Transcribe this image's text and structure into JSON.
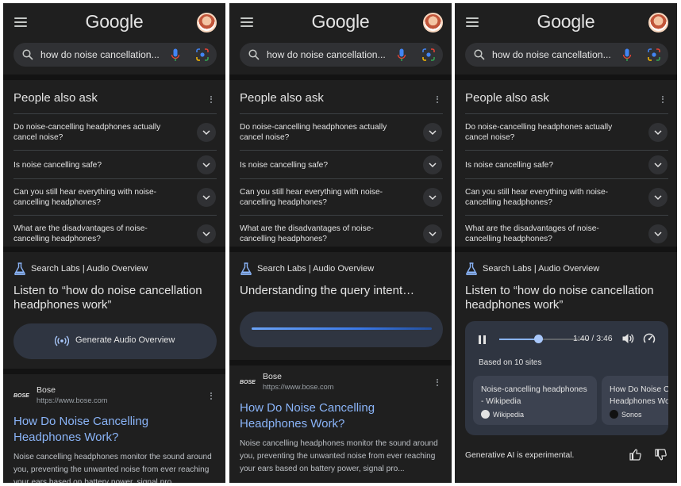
{
  "header": {
    "logo": "Google"
  },
  "search": {
    "query": "how do noise cancellation..."
  },
  "paa": {
    "title": "People also ask",
    "questions": [
      "Do noise-cancelling headphones actually cancel noise?",
      "Is noise cancelling safe?",
      "Can you still hear everything with noise-cancelling headphones?",
      "What are the disadvantages of noise-cancelling headphones?"
    ]
  },
  "audio": {
    "labs_label": "Search Labs | Audio Overview",
    "prompt": "Listen to “how do noise cancellation headphones work”",
    "generate_label": "Generate Audio Overview",
    "loading_text": "Understanding the query intent…",
    "player": {
      "time": "1:40 / 3:46",
      "progress": 0.44,
      "based_on": "Based on 10 sites",
      "sources": [
        {
          "title": "Noise-cancelling headphones - Wikipedia",
          "site": "Wikipedia"
        },
        {
          "title": "How Do Noise Cancelling Headphones Work?",
          "site": "Sonos"
        }
      ]
    },
    "experimental": "Generative AI is experimental."
  },
  "result": {
    "site": "Bose",
    "url": "https://www.bose.com",
    "title": "How Do Noise Cancelling Headphones Work?",
    "snippet": "Noise cancelling headphones monitor the sound around you, preventing the unwanted noise from ever reaching your ears based on battery power, signal pro..."
  },
  "colors": {
    "link": "#8ab4f8",
    "background": "#1f1f1f",
    "card": "#2f3541"
  }
}
